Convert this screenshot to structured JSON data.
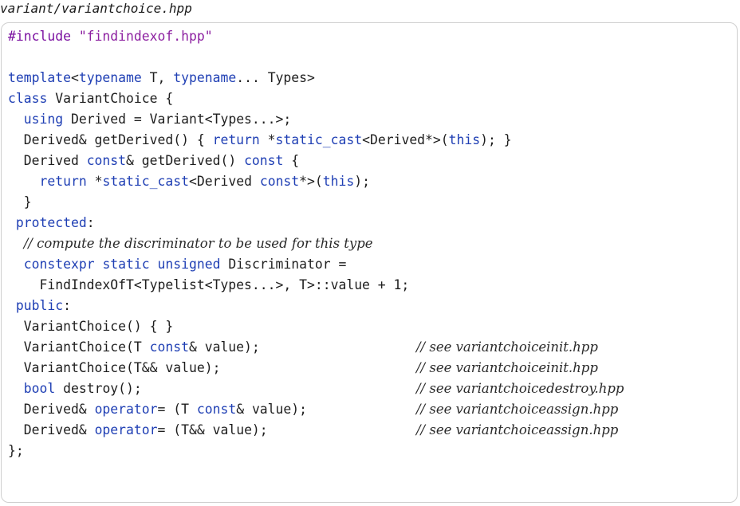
{
  "file_name": "variant/variantchoice.hpp",
  "colors": {
    "keyword": "#1f3fb4",
    "string": "#8c1fa0",
    "directive": "#7a0fa0",
    "text": "#1e1e1e",
    "comment": "#2a2a2a",
    "box_border": "#cfcfcf"
  },
  "code_lines": [
    {
      "tokens": [
        [
          "directive",
          "#include "
        ],
        [
          "string",
          "\"findindexof.hpp\""
        ]
      ]
    },
    {
      "tokens": []
    },
    {
      "tokens": [
        [
          "keyword",
          "template"
        ],
        [
          "text",
          "<"
        ],
        [
          "keyword",
          "typename"
        ],
        [
          "text",
          " T, "
        ],
        [
          "keyword",
          "typename"
        ],
        [
          "text",
          "... Types>"
        ]
      ]
    },
    {
      "tokens": [
        [
          "keyword",
          "class"
        ],
        [
          "text",
          " VariantChoice {"
        ]
      ]
    },
    {
      "tokens": [
        [
          "text",
          "  "
        ],
        [
          "keyword",
          "using"
        ],
        [
          "text",
          " Derived = Variant<Types...>;"
        ]
      ]
    },
    {
      "tokens": [
        [
          "text",
          "  Derived& getDerived() { "
        ],
        [
          "keyword",
          "return"
        ],
        [
          "text",
          " *"
        ],
        [
          "keyword",
          "static_cast"
        ],
        [
          "text",
          "<Derived*>("
        ],
        [
          "keyword",
          "this"
        ],
        [
          "text",
          "); }"
        ]
      ]
    },
    {
      "tokens": [
        [
          "text",
          "  Derived "
        ],
        [
          "keyword",
          "const"
        ],
        [
          "text",
          "& getDerived() "
        ],
        [
          "keyword",
          "const"
        ],
        [
          "text",
          " {"
        ]
      ]
    },
    {
      "tokens": [
        [
          "text",
          "    "
        ],
        [
          "keyword",
          "return"
        ],
        [
          "text",
          " *"
        ],
        [
          "keyword",
          "static_cast"
        ],
        [
          "text",
          "<Derived "
        ],
        [
          "keyword",
          "const"
        ],
        [
          "text",
          "*>("
        ],
        [
          "keyword",
          "this"
        ],
        [
          "text",
          ");"
        ]
      ]
    },
    {
      "tokens": [
        [
          "text",
          "  }"
        ]
      ]
    },
    {
      "tokens": [
        [
          "text",
          " "
        ],
        [
          "keyword",
          "protected"
        ],
        [
          "text",
          ":"
        ]
      ]
    },
    {
      "tokens": [
        [
          "text",
          "  "
        ],
        [
          "comment",
          "// compute the discriminator to be used for this type"
        ]
      ]
    },
    {
      "tokens": [
        [
          "text",
          "  "
        ],
        [
          "keyword",
          "constexpr"
        ],
        [
          "text",
          " "
        ],
        [
          "keyword",
          "static"
        ],
        [
          "text",
          " "
        ],
        [
          "keyword",
          "unsigned"
        ],
        [
          "text",
          " Discriminator ="
        ]
      ]
    },
    {
      "tokens": [
        [
          "text",
          "    FindIndexOfT<Typelist<Types...>, T>::value + 1;"
        ]
      ]
    },
    {
      "tokens": [
        [
          "text",
          " "
        ],
        [
          "keyword",
          "public"
        ],
        [
          "text",
          ":"
        ]
      ]
    },
    {
      "tokens": [
        [
          "text",
          "  VariantChoice() { }"
        ]
      ]
    },
    {
      "tokens": [
        [
          "text",
          "  VariantChoice(T "
        ],
        [
          "keyword",
          "const"
        ],
        [
          "text",
          "& value);"
        ]
      ],
      "comment": "// see variantchoiceinit.hpp"
    },
    {
      "tokens": [
        [
          "text",
          "  VariantChoice(T&& value);"
        ]
      ],
      "comment": "// see variantchoiceinit.hpp"
    },
    {
      "tokens": [
        [
          "text",
          "  "
        ],
        [
          "keyword",
          "bool"
        ],
        [
          "text",
          " destroy();"
        ]
      ],
      "comment": "// see variantchoicedestroy.hpp"
    },
    {
      "tokens": [
        [
          "text",
          "  Derived& "
        ],
        [
          "keyword",
          "operator"
        ],
        [
          "text",
          "= (T "
        ],
        [
          "keyword",
          "const"
        ],
        [
          "text",
          "& value);"
        ]
      ],
      "comment": "// see variantchoiceassign.hpp"
    },
    {
      "tokens": [
        [
          "text",
          "  Derived& "
        ],
        [
          "keyword",
          "operator"
        ],
        [
          "text",
          "= (T&& value);"
        ]
      ],
      "comment": "// see variantchoiceassign.hpp"
    },
    {
      "tokens": [
        [
          "text",
          "};"
        ]
      ]
    }
  ]
}
